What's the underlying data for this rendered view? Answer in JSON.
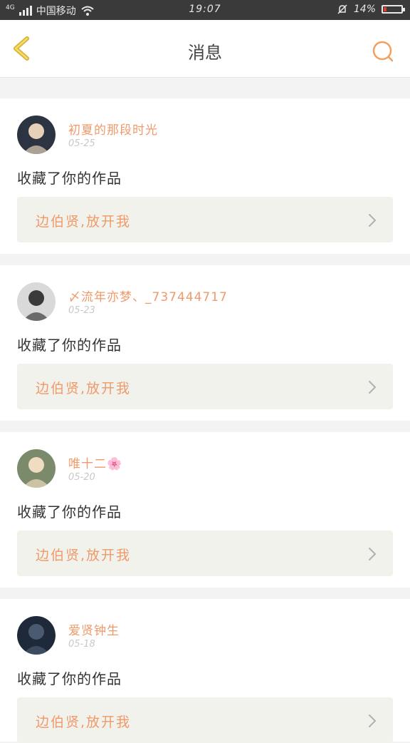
{
  "statusbar": {
    "network": "4G",
    "carrier": "中国移动",
    "time": "19:07",
    "battery": "14%",
    "battery_level": 0.14
  },
  "header": {
    "title": "消息",
    "back_icon": "back-chevron-icon",
    "search_icon": "search-icon",
    "accent": "#f0a060"
  },
  "messages": [
    {
      "name": "初夏的那段时光",
      "date": "05-25",
      "action": "收藏了你的作品",
      "work": "边伯贤,放开我",
      "avatar": "avatar-image"
    },
    {
      "name": "〆流年亦梦、_737444717",
      "date": "05-23",
      "action": "收藏了你的作品",
      "work": "边伯贤,放开我",
      "avatar": "avatar-image"
    },
    {
      "name": "唯十二🌸",
      "date": "05-20",
      "action": "收藏了你的作品",
      "work": "边伯贤,放开我",
      "avatar": "avatar-image"
    },
    {
      "name": "爱贤钟生",
      "date": "05-18",
      "action": "收藏了你的作品",
      "work": "边伯贤,放开我",
      "avatar": "avatar-image"
    }
  ]
}
